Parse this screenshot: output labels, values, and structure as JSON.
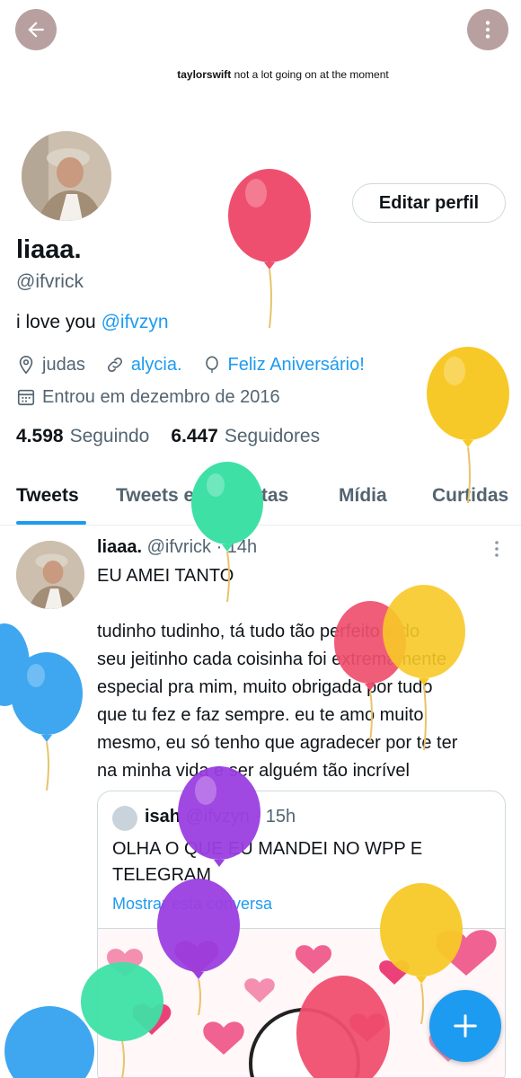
{
  "header": {
    "back_icon": "arrow-left-icon",
    "more_icon": "more-vertical-icon",
    "banner_user": "taylorswift",
    "banner_text": "not a lot going on at the moment"
  },
  "profile": {
    "display_name": "liaaa.",
    "handle": "@ifvrick",
    "bio_text": "i love you ",
    "bio_mention": "@ifvzyn",
    "edit_button": "Editar perfil",
    "location": "judas",
    "website": "alycia.",
    "birthday": "Feliz Aniversário!",
    "joined": "Entrou em dezembro de 2016",
    "following_count": "4.598",
    "following_label": "Seguindo",
    "followers_count": "6.447",
    "followers_label": "Seguidores"
  },
  "tabs": [
    {
      "label": "Tweets",
      "active": true
    },
    {
      "label": "Tweets e respostas",
      "active": false
    },
    {
      "label": "Mídia",
      "active": false
    },
    {
      "label": "Curtidas",
      "active": false
    }
  ],
  "tweet": {
    "name": "liaaa.",
    "handle": "@ifvrick",
    "time": "· 14h",
    "line1": "EU AMEI TANTO",
    "lines": [
      "tudinho tudinho, tá tudo tão perfeito e do",
      "seu jeitinho cada coisinha foi extremamente",
      "especial pra mim, muito obrigada por tudo",
      "que tu fez e faz sempre. eu te amo muito",
      "mesmo, eu só tenho que agradecer por te ter",
      "na minha vida e ser alguém tão incrível"
    ],
    "quote": {
      "name": "isah",
      "handle": "@ifvzyn",
      "time": "· 15h",
      "text": "OLHA O QUE EU MANDEI NO WPP E TELEGRAM",
      "show_thread": "Mostrar esta conversa"
    }
  },
  "fab_icon": "plus-icon",
  "colors": {
    "accent": "#1d9bf0",
    "balloon_red": "#ef4f6e",
    "balloon_yellow": "#f7c928",
    "balloon_green": "#3ee0a6",
    "balloon_blue": "#3fa7f0",
    "balloon_purple": "#9b3fe0"
  }
}
